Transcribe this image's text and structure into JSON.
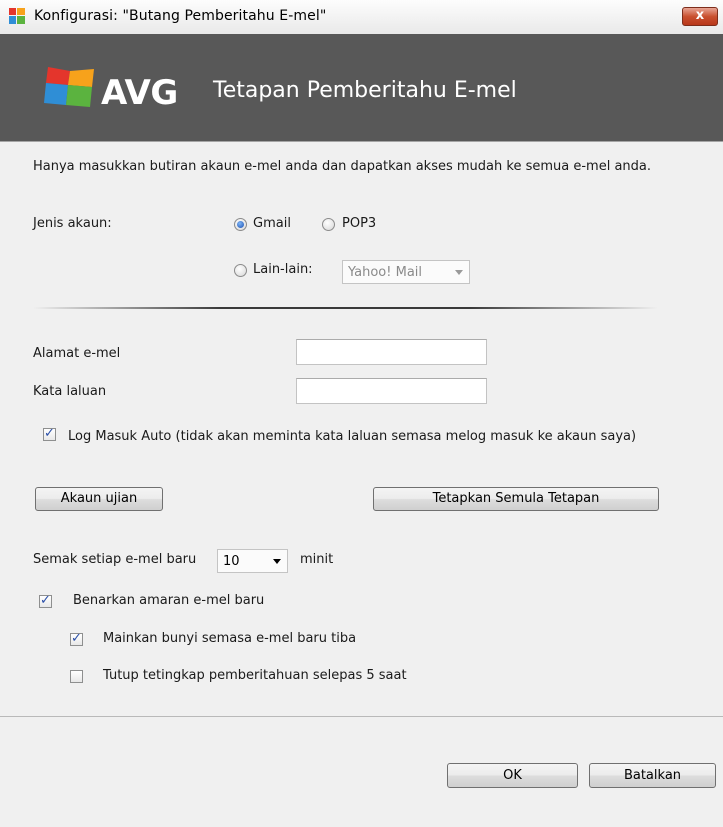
{
  "window": {
    "title": "Konfigurasi: \"Butang Pemberitahu E-mel\"",
    "close_label": "x"
  },
  "header": {
    "logo_text": "AVG",
    "title": "Tetapan Pemberitahu E-mel"
  },
  "intro": "Hanya masukkan butiran akaun e-mel anda dan dapatkan akses mudah ke semua e-mel anda.",
  "account": {
    "label": "Jenis akaun:",
    "options": [
      "Gmail",
      "POP3",
      "Lain-lain:"
    ],
    "selected": "Gmail",
    "other_select_value": "Yahoo! Mail"
  },
  "fields": {
    "email_label": "Alamat e-mel",
    "email_value": "",
    "password_label": "Kata laluan",
    "password_value": ""
  },
  "auto_login": {
    "label": "Log Masuk Auto (tidak akan meminta kata laluan semasa melog masuk ke akaun saya)",
    "checked": true
  },
  "buttons": {
    "test_account": "Akaun ujian",
    "reset_defaults": "Tetapkan Semula Tetapan"
  },
  "check_interval": {
    "prefix": "Semak setiap e-mel baru",
    "value": "10",
    "suffix": "minit"
  },
  "notify": {
    "enable_label": "Benarkan amaran e-mel baru",
    "enable_checked": true,
    "sound_label": "Mainkan bunyi semasa e-mel baru tiba",
    "sound_checked": true,
    "close_label": "Tutup tetingkap pemberitahuan selepas 5 saat",
    "close_checked": false
  },
  "footer": {
    "ok_label": "OK",
    "cancel_label": "Batalkan"
  },
  "colors": {
    "header_bg": "#585858",
    "close_red": "#c9502f",
    "radio_blue": "#1b4fb3"
  }
}
